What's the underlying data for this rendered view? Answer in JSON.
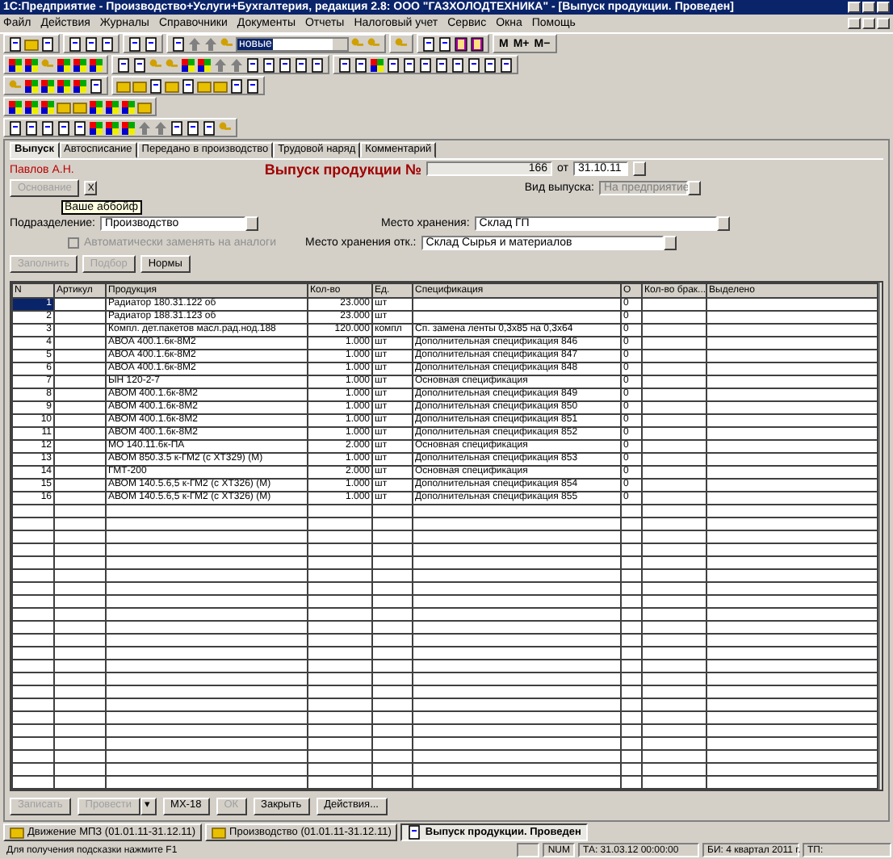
{
  "window": {
    "title": "1С:Предприятие - Производство+Услуги+Бухгалтерия, редакция 2.8: ООО \"ГАЗХОЛОДТЕХНИКА\" - [Выпуск продукции. Проведен]"
  },
  "menu": [
    "Файл",
    "Действия",
    "Журналы",
    "Справочники",
    "Документы",
    "Отчеты",
    "Налоговый учет",
    "Сервис",
    "Окна",
    "Помощь"
  ],
  "toolbar": {
    "combo_value": "новые",
    "memory_buttons": [
      "М",
      "М+",
      "М−"
    ]
  },
  "tabs": [
    {
      "label": "Выпуск",
      "selected": true
    },
    {
      "label": "Автосписание",
      "selected": false
    },
    {
      "label": "Передано в производство",
      "selected": false
    },
    {
      "label": "Трудовой наряд",
      "selected": false
    },
    {
      "label": "Комментарий",
      "selected": false
    }
  ],
  "form": {
    "author": "Павлов А.Н.",
    "doc_title": "Выпуск продукции №",
    "number": "166",
    "date_label": "от",
    "date": "31.10.11",
    "basis_button": {
      "label": "Основание",
      "disabled": true
    },
    "clear_button": "X",
    "tooltip": "Ваше аббойф",
    "release_type_label": "Вид выпуска:",
    "release_type": {
      "value": "На предприятие",
      "disabled": true
    },
    "division_label": "Подразделение:",
    "division": "Производство",
    "storage_label": "Место хранения:",
    "storage": "Склад ГП",
    "storage2_label": "Место хранения отк.:",
    "storage2": "Склад Сырья и материалов",
    "analog_checkbox": {
      "label": "Автоматически заменять на аналоги",
      "checked": false,
      "disabled": true
    },
    "buttons": [
      {
        "label": "Заполнить",
        "disabled": true
      },
      {
        "label": "Подбор",
        "disabled": true
      },
      {
        "label": "Нормы",
        "disabled": false
      }
    ]
  },
  "table": {
    "columns": [
      "N",
      "Артикул",
      "Продукция",
      "Кол-во",
      "Ед.",
      "Спецификация",
      "О",
      "Кол-во брак...",
      "Выделено"
    ],
    "rows": [
      {
        "selected": true,
        "cells": [
          "1",
          "",
          "Радиатор 180.31.122 об",
          "23.000",
          "шт",
          "",
          "0",
          "",
          ""
        ]
      },
      {
        "selected": false,
        "cells": [
          "2",
          "",
          "Радиатор 188.31.123 об",
          "23.000",
          "шт",
          "",
          "0",
          "",
          ""
        ]
      },
      {
        "selected": false,
        "cells": [
          "3",
          "",
          "Компл. дет.пакетов масл.рад.нод.188",
          "120.000",
          "компл",
          "Сп. замена ленты 0,3х85 на 0,3х64",
          "0",
          "",
          ""
        ]
      },
      {
        "selected": false,
        "cells": [
          "4",
          "",
          "АВОА 400.1.6к-8М2",
          "1.000",
          "шт",
          "Дополнительная спецификация 846",
          "0",
          "",
          ""
        ]
      },
      {
        "selected": false,
        "cells": [
          "5",
          "",
          "АВОА 400.1.6к-8М2",
          "1.000",
          "шт",
          "Дополнительная спецификация 847",
          "0",
          "",
          ""
        ]
      },
      {
        "selected": false,
        "cells": [
          "6",
          "",
          "АВОА 400.1.6к-8М2",
          "1.000",
          "шт",
          "Дополнительная спецификация 848",
          "0",
          "",
          ""
        ]
      },
      {
        "selected": false,
        "cells": [
          "7",
          "",
          "ЫН 120-2-7",
          "1.000",
          "шт",
          "Основная спецификация",
          "0",
          "",
          ""
        ]
      },
      {
        "selected": false,
        "cells": [
          "8",
          "",
          "АВОМ 400.1.6к-8М2",
          "1.000",
          "шт",
          "Дополнительная спецификация 849",
          "0",
          "",
          ""
        ]
      },
      {
        "selected": false,
        "cells": [
          "9",
          "",
          "АВОМ 400.1.6к-8М2",
          "1.000",
          "шт",
          "Дополнительная спецификация 850",
          "0",
          "",
          ""
        ]
      },
      {
        "selected": false,
        "cells": [
          "10",
          "",
          "АВОМ 400.1.6к-8М2",
          "1.000",
          "шт",
          "Дополнительная спецификация 851",
          "0",
          "",
          ""
        ]
      },
      {
        "selected": false,
        "cells": [
          "11",
          "",
          "АВОМ 400.1.6к-8М2",
          "1.000",
          "шт",
          "Дополнительная спецификация 852",
          "0",
          "",
          ""
        ]
      },
      {
        "selected": false,
        "cells": [
          "12",
          "",
          "МО 140.11.6к-ПА",
          "2.000",
          "шт",
          "Основная спецификация",
          "0",
          "",
          ""
        ]
      },
      {
        "selected": false,
        "cells": [
          "13",
          "",
          "АВОМ 850.3.5 к-ГМ2 (с ХТ329) (М)",
          "1.000",
          "шт",
          "Дополнительная спецификация 853",
          "0",
          "",
          ""
        ]
      },
      {
        "selected": false,
        "cells": [
          "14",
          "",
          "ГМТ-200",
          "2.000",
          "шт",
          "Основная спецификация",
          "0",
          "",
          ""
        ]
      },
      {
        "selected": false,
        "cells": [
          "15",
          "",
          "АВОМ 140.5.6,5 к-ГМ2 (с ХТ326) (М)",
          "1.000",
          "шт",
          "Дополнительная спецификация 854",
          "0",
          "",
          ""
        ]
      },
      {
        "selected": false,
        "cells": [
          "16",
          "",
          "АВОМ 140.5.6,5 к-ГМ2 (с ХТ326) (М)",
          "1.000",
          "шт",
          "Дополнительная спецификация 855",
          "0",
          "",
          ""
        ]
      }
    ]
  },
  "footer_buttons": [
    {
      "label": "Записать",
      "disabled": true,
      "kind": "button"
    },
    {
      "label": "Провести",
      "disabled": true,
      "kind": "button"
    },
    {
      "label": "▾",
      "disabled": false,
      "kind": "arrow"
    },
    {
      "label": "МХ-18",
      "disabled": false,
      "kind": "button"
    },
    {
      "label": "ОК",
      "disabled": true,
      "kind": "button"
    },
    {
      "label": "Закрыть",
      "disabled": false,
      "kind": "button"
    },
    {
      "label": "Действия...",
      "disabled": false,
      "kind": "button"
    }
  ],
  "taskbar": [
    {
      "label": "Движение МПЗ (01.01.11-31.12.11)",
      "selected": false
    },
    {
      "label": "Производство (01.01.11-31.12.11)",
      "selected": false
    },
    {
      "label": "Выпуск продукции. Проведен",
      "selected": true
    }
  ],
  "status_bar": {
    "hint": "Для получения подсказки нажмите F1",
    "num": "NUM",
    "ta": "ТА: 31.03.12 00:00:00",
    "bi": "БИ: 4 квартал 2011 г.",
    "tp": "ТП:"
  }
}
